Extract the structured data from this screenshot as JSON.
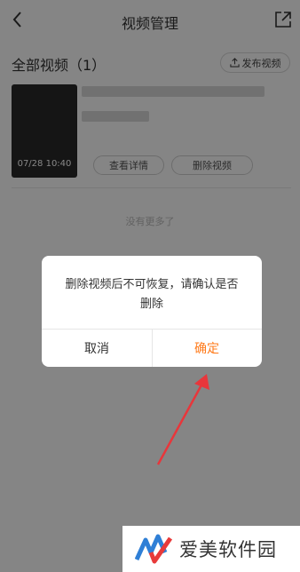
{
  "header": {
    "title": "视频管理"
  },
  "section": {
    "title": "全部视频（1）",
    "publish_label": "发布视频"
  },
  "video": {
    "timestamp": "07/28 10:40",
    "detail_label": "查看详情",
    "delete_label": "删除视频"
  },
  "list": {
    "no_more": "没有更多了"
  },
  "dialog": {
    "message": "删除视频后不可恢复，请确认是否删除",
    "cancel_label": "取消",
    "confirm_label": "确定"
  },
  "watermark": {
    "text": "爱美软件园"
  },
  "colors": {
    "accent": "#ff7a1a",
    "arrow": "#e8363b"
  },
  "icons": [
    "back-icon",
    "share-icon",
    "upload-icon"
  ]
}
